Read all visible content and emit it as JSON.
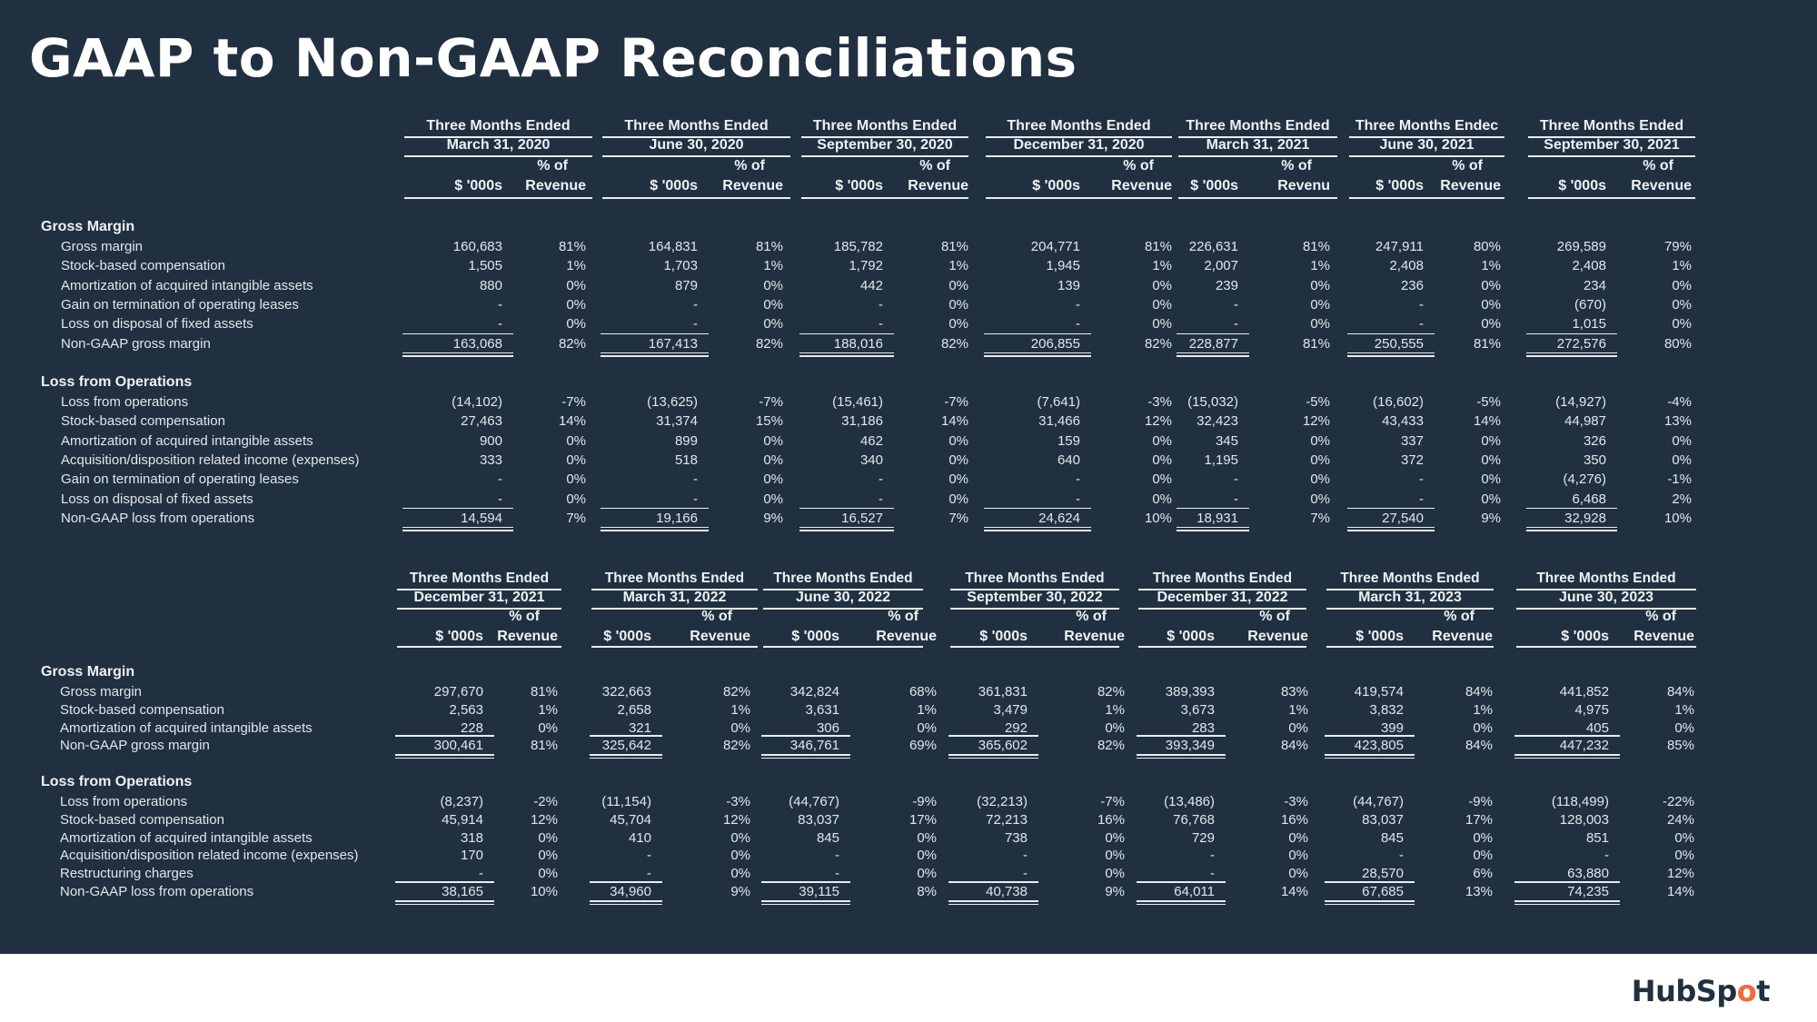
{
  "title": "GAAP to Non-GAAP Reconciliations",
  "logo": {
    "text_a": "HubSp",
    "text_b": "o",
    "text_c": "t",
    "accent": "#f26a3d"
  },
  "colors": {
    "background": "#213040",
    "text": "#e1e6ec",
    "footer": "#ffffff"
  },
  "common": {
    "period_prefix": "Three Months Ended",
    "col_value": "$ '000s",
    "col_pct_top": "% of",
    "col_pct_bottom": "Revenue"
  },
  "table1": {
    "periods": [
      {
        "heading": "Three Months Ended",
        "date": "March 31, 2020",
        "pct_label": "Revenue"
      },
      {
        "heading": "Three Months Ended",
        "date": "June 30, 2020",
        "pct_label": "Revenue"
      },
      {
        "heading": "Three Months Ended",
        "date": "September 30, 2020",
        "pct_label": "Revenue"
      },
      {
        "heading": "Three Months Ended",
        "date": "December 31, 2020",
        "pct_label": "Revenue"
      },
      {
        "heading": "Three Months Ended",
        "date": "March 31, 2021",
        "pct_label": "Revenu"
      },
      {
        "heading": "Three Months Endec",
        "date": "June 30, 2021",
        "pct_label": "Revenue"
      },
      {
        "heading": "Three Months Ended",
        "date": "September 30, 2021",
        "pct_label": "Revenue"
      }
    ],
    "sections": [
      {
        "title": "Gross Margin",
        "rows": [
          {
            "label": "Gross margin",
            "values": [
              "160,683",
              "164,831",
              "185,782",
              "204,771",
              "226,631",
              "247,911",
              "269,589"
            ],
            "pcts": [
              "81%",
              "81%",
              "81%",
              "81%",
              "81%",
              "80%",
              "79%"
            ]
          },
          {
            "label": "Stock-based compensation",
            "values": [
              "1,505",
              "1,703",
              "1,792",
              "1,945",
              "2,007",
              "2,408",
              "2,408"
            ],
            "pcts": [
              "1%",
              "1%",
              "1%",
              "1%",
              "1%",
              "1%",
              "1%"
            ]
          },
          {
            "label": "Amortization of acquired intangible assets",
            "values": [
              "880",
              "879",
              "442",
              "139",
              "239",
              "236",
              "234"
            ],
            "pcts": [
              "0%",
              "0%",
              "0%",
              "0%",
              "0%",
              "0%",
              "0%"
            ]
          },
          {
            "label": "Gain on termination of operating leases",
            "values": [
              "-",
              "-",
              "-",
              "-",
              "-",
              "-",
              "(670)"
            ],
            "pcts": [
              "0%",
              "0%",
              "0%",
              "0%",
              "0%",
              "0%",
              "0%"
            ]
          },
          {
            "label": "Loss on disposal of fixed assets",
            "values": [
              "-",
              "-",
              "-",
              "-",
              "-",
              "-",
              "1,015"
            ],
            "pcts": [
              "0%",
              "0%",
              "0%",
              "0%",
              "0%",
              "0%",
              "0%"
            ]
          },
          {
            "label": "Non-GAAP gross margin",
            "total": true,
            "values": [
              "163,068",
              "167,413",
              "188,016",
              "206,855",
              "228,877",
              "250,555",
              "272,576"
            ],
            "pcts": [
              "82%",
              "82%",
              "82%",
              "82%",
              "81%",
              "81%",
              "80%"
            ]
          }
        ]
      },
      {
        "title": "Loss from Operations",
        "rows": [
          {
            "label": "Loss from operations",
            "values": [
              "(14,102)",
              "(13,625)",
              "(15,461)",
              "(7,641)",
              "(15,032)",
              "(16,602)",
              "(14,927)"
            ],
            "pcts": [
              "-7%",
              "-7%",
              "-7%",
              "-3%",
              "-5%",
              "-5%",
              "-4%"
            ]
          },
          {
            "label": "Stock-based compensation",
            "values": [
              "27,463",
              "31,374",
              "31,186",
              "31,466",
              "32,423",
              "43,433",
              "44,987"
            ],
            "pcts": [
              "14%",
              "15%",
              "14%",
              "12%",
              "12%",
              "14%",
              "13%"
            ]
          },
          {
            "label": "Amortization of acquired intangible assets",
            "values": [
              "900",
              "899",
              "462",
              "159",
              "345",
              "337",
              "326"
            ],
            "pcts": [
              "0%",
              "0%",
              "0%",
              "0%",
              "0%",
              "0%",
              "0%"
            ]
          },
          {
            "label": "Acquisition/disposition related income (expenses)",
            "values": [
              "333",
              "518",
              "340",
              "640",
              "1,195",
              "372",
              "350"
            ],
            "pcts": [
              "0%",
              "0%",
              "0%",
              "0%",
              "0%",
              "0%",
              "0%"
            ]
          },
          {
            "label": "Gain on termination of operating leases",
            "values": [
              "-",
              "-",
              "-",
              "-",
              "-",
              "-",
              "(4,276)"
            ],
            "pcts": [
              "0%",
              "0%",
              "0%",
              "0%",
              "0%",
              "0%",
              "-1%"
            ]
          },
          {
            "label": "Loss on disposal of fixed assets",
            "values": [
              "-",
              "-",
              "-",
              "-",
              "-",
              "-",
              "6,468"
            ],
            "pcts": [
              "0%",
              "0%",
              "0%",
              "0%",
              "0%",
              "0%",
              "2%"
            ]
          },
          {
            "label": "Non-GAAP loss from operations",
            "total": true,
            "values": [
              "14,594",
              "19,166",
              "16,527",
              "24,624",
              "18,931",
              "27,540",
              "32,928"
            ],
            "pcts": [
              "7%",
              "9%",
              "7%",
              "10%",
              "7%",
              "9%",
              "10%"
            ]
          }
        ]
      }
    ]
  },
  "table2": {
    "periods": [
      {
        "heading": "Three Months Ended",
        "date": "December 31, 2021",
        "pct_label": "Revenue"
      },
      {
        "heading": "Three Months Ended",
        "date": "March 31, 2022",
        "pct_label": "Revenue"
      },
      {
        "heading": "Three Months Ended",
        "date": "June 30, 2022",
        "pct_label": "Revenue"
      },
      {
        "heading": "Three Months Ended",
        "date": "September 30, 2022",
        "pct_label": "Revenue"
      },
      {
        "heading": "Three Months Ended",
        "date": "December 31, 2022",
        "pct_label": "Revenue"
      },
      {
        "heading": "Three Months Ended",
        "date": "March 31, 2023",
        "pct_label": "Revenue"
      },
      {
        "heading": "Three Months Ended",
        "date": "June 30, 2023",
        "pct_label": "Revenue"
      }
    ],
    "sections": [
      {
        "title": "Gross Margin",
        "rows": [
          {
            "label": "Gross margin",
            "values": [
              "297,670",
              "322,663",
              "342,824",
              "361,831",
              "389,393",
              "419,574",
              "441,852"
            ],
            "pcts": [
              "81%",
              "82%",
              "68%",
              "82%",
              "83%",
              "84%",
              "84%"
            ]
          },
          {
            "label": "Stock-based compensation",
            "values": [
              "2,563",
              "2,658",
              "3,631",
              "3,479",
              "3,673",
              "3,832",
              "4,975"
            ],
            "pcts": [
              "1%",
              "1%",
              "1%",
              "1%",
              "1%",
              "1%",
              "1%"
            ]
          },
          {
            "label": "Amortization of acquired intangible assets",
            "values": [
              "228",
              "321",
              "306",
              "292",
              "283",
              "399",
              "405"
            ],
            "pcts": [
              "0%",
              "0%",
              "0%",
              "0%",
              "0%",
              "0%",
              "0%"
            ]
          },
          {
            "label": "Non-GAAP gross margin",
            "total": true,
            "values": [
              "300,461",
              "325,642",
              "346,761",
              "365,602",
              "393,349",
              "423,805",
              "447,232"
            ],
            "pcts": [
              "81%",
              "82%",
              "69%",
              "82%",
              "84%",
              "84%",
              "85%"
            ]
          }
        ]
      },
      {
        "title": "Loss from Operations",
        "rows": [
          {
            "label": "Loss from operations",
            "values": [
              "(8,237)",
              "(11,154)",
              "(44,767)",
              "(32,213)",
              "(13,486)",
              "(44,767)",
              "(118,499)"
            ],
            "pcts": [
              "-2%",
              "-3%",
              "-9%",
              "-7%",
              "-3%",
              "-9%",
              "-22%"
            ]
          },
          {
            "label": "Stock-based compensation",
            "values": [
              "45,914",
              "45,704",
              "83,037",
              "72,213",
              "76,768",
              "83,037",
              "128,003"
            ],
            "pcts": [
              "12%",
              "12%",
              "17%",
              "16%",
              "16%",
              "17%",
              "24%"
            ]
          },
          {
            "label": "Amortization of acquired intangible assets",
            "values": [
              "318",
              "410",
              "845",
              "738",
              "729",
              "845",
              "851"
            ],
            "pcts": [
              "0%",
              "0%",
              "0%",
              "0%",
              "0%",
              "0%",
              "0%"
            ]
          },
          {
            "label": "Acquisition/disposition related income (expenses)",
            "values": [
              "170",
              "-",
              "-",
              "-",
              "-",
              "-",
              "-"
            ],
            "pcts": [
              "0%",
              "0%",
              "0%",
              "0%",
              "0%",
              "0%",
              "0%"
            ]
          },
          {
            "label": "Restructuring charges",
            "values": [
              "-",
              "-",
              "-",
              "-",
              "-",
              "28,570",
              "63,880"
            ],
            "pcts": [
              "0%",
              "0%",
              "0%",
              "0%",
              "0%",
              "6%",
              "12%"
            ]
          },
          {
            "label": "Non-GAAP loss from operations",
            "total": true,
            "values": [
              "38,165",
              "34,960",
              "39,115",
              "40,738",
              "64,011",
              "67,685",
              "74,235"
            ],
            "pcts": [
              "10%",
              "9%",
              "8%",
              "9%",
              "14%",
              "13%",
              "14%"
            ]
          }
        ]
      }
    ]
  }
}
